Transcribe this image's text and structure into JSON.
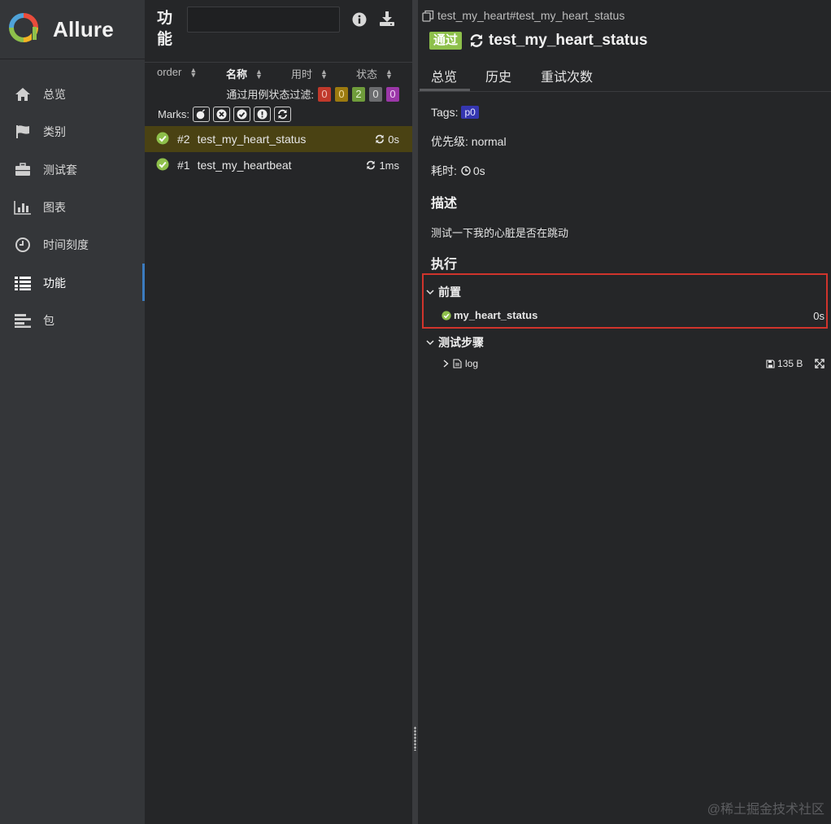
{
  "brand": {
    "name": "Allure"
  },
  "nav": [
    {
      "label": "总览",
      "icon": "home-icon"
    },
    {
      "label": "类别",
      "icon": "flag-icon"
    },
    {
      "label": "测试套",
      "icon": "briefcase-icon"
    },
    {
      "label": "图表",
      "icon": "bar-chart-icon"
    },
    {
      "label": "时间刻度",
      "icon": "clock-icon"
    },
    {
      "label": "功能",
      "icon": "list-icon",
      "active": true
    },
    {
      "label": "包",
      "icon": "align-left-icon"
    }
  ],
  "tree": {
    "title": "功能",
    "search_value": "",
    "sort_columns": [
      "order",
      "名称",
      "用时",
      "状态"
    ],
    "filter_label": "通过用例状态过滤:",
    "status_counts": [
      {
        "value": "0",
        "color": "#c0392b"
      },
      {
        "value": "0",
        "color": "#9c7a0f"
      },
      {
        "value": "2",
        "color": "#6f9c3b"
      },
      {
        "value": "0",
        "color": "#6b6c6f"
      },
      {
        "value": "0",
        "color": "#9b37a8"
      }
    ],
    "marks_label": "Marks:",
    "marks_icons": [
      "flaky-bomb-icon",
      "new-failed-icon",
      "new-passed-icon",
      "new-broken-icon",
      "retries-icon"
    ],
    "items": [
      {
        "num": "#2",
        "name": "test_my_heart_status",
        "duration": "0s",
        "selected": true
      },
      {
        "num": "#1",
        "name": "test_my_heartbeat",
        "duration": "1ms",
        "selected": false
      }
    ]
  },
  "detail": {
    "breadcrumb": "test_my_heart#test_my_heart_status",
    "status": "通过",
    "title": "test_my_heart_status",
    "tabs": [
      "总览",
      "历史",
      "重试次数"
    ],
    "tags_label": "Tags:",
    "tag": "p0",
    "priority": "优先级: normal",
    "duration_label": "耗时:",
    "duration": "0s",
    "description_title": "描述",
    "description": "测试一下我的心脏是否在跳动",
    "execution_title": "执行",
    "setup_title": "前置",
    "setup_item": "my_heart_status",
    "setup_duration": "0s",
    "steps_title": "测试步骤",
    "attachment_name": "log",
    "attachment_size": "135 B"
  },
  "watermark": "@稀土掘金技术社区",
  "colors": {
    "passed": "#8ec04b",
    "selected_row": "#4a4213",
    "highlight": "#d0342c"
  }
}
